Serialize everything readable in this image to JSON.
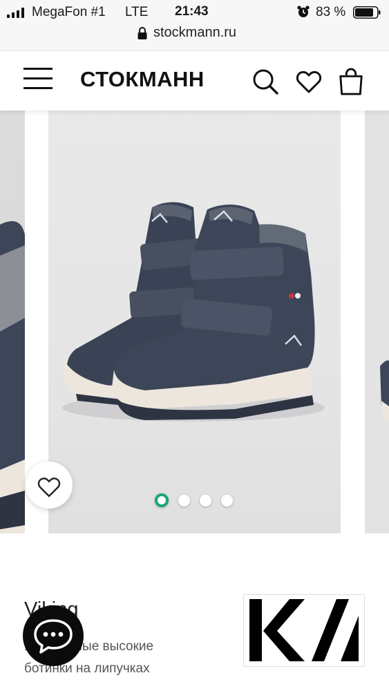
{
  "status_bar": {
    "carrier": "MegaFon #1",
    "network": "LTE",
    "time": "21:43",
    "battery_percent": "83 %",
    "icons": [
      "signal-icon",
      "alarm-icon",
      "battery-icon"
    ]
  },
  "browser": {
    "url": "stockmann.ru",
    "icons": [
      "lock-icon"
    ]
  },
  "header": {
    "brand": "СТОКМАНН",
    "icons": [
      "menu-icon",
      "search-icon",
      "heart-icon",
      "shopping-bag-icon"
    ]
  },
  "gallery": {
    "slide_count": 4,
    "active_slide": 1,
    "favorite_icon": "heart-outline-icon"
  },
  "product": {
    "brand": "Viking",
    "title_line1": "Утеплённые высокие",
    "title_line2": "ботинки на липучках"
  },
  "chat": {
    "icon": "chat-bubble-icon"
  },
  "colors": {
    "accent": "#1aa37a",
    "boot_navy": "#3d4658",
    "sole": "#ece6dd"
  }
}
